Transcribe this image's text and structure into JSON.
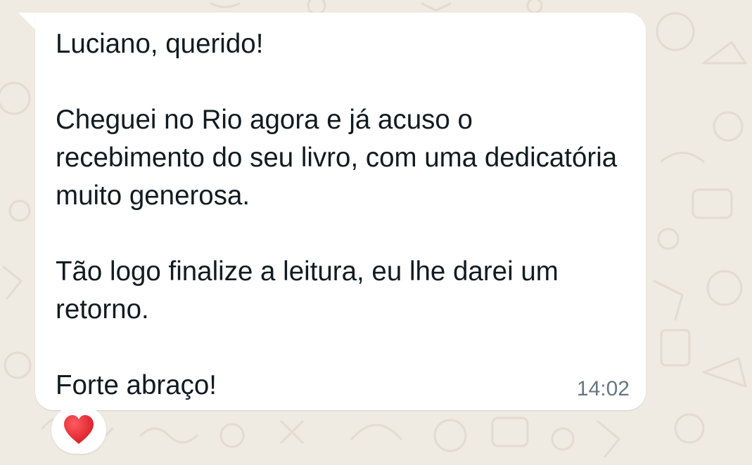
{
  "message": {
    "text": "Luciano, querido!\n\nCheguei no Rio agora e já acuso o recebimento do seu livro, com uma dedicatória muito generosa.\n\nTão logo finalize a leitura, eu lhe darei um retorno.\n\nForte abraço!",
    "time": "14:02"
  },
  "reaction": {
    "emoji_name": "red-heart-icon",
    "color": "#e8242f"
  },
  "colors": {
    "wallpaper": "#efeae2",
    "bubble": "#ffffff",
    "text": "#111b21",
    "timestamp": "#667781"
  }
}
